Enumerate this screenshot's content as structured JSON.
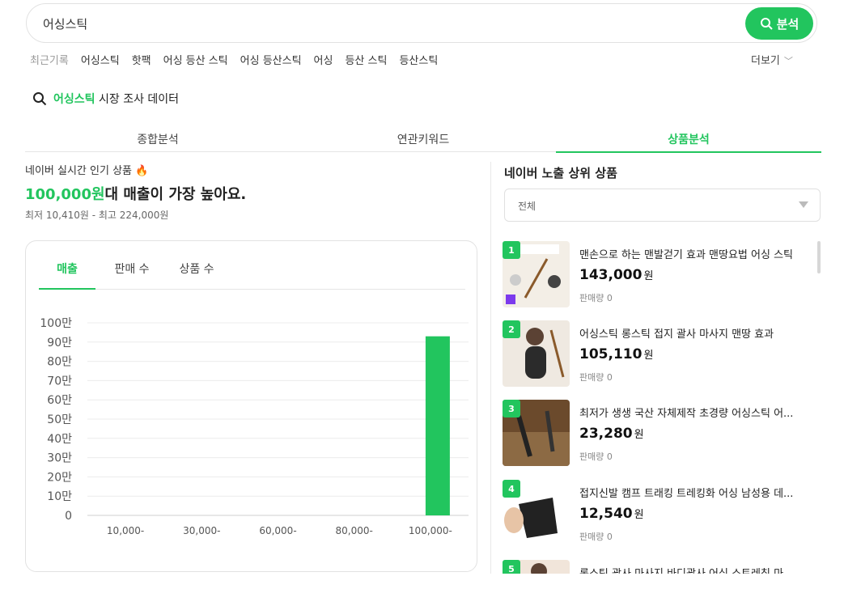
{
  "search": {
    "query": "어싱스틱",
    "button_label": "분석"
  },
  "recent": {
    "label": "최근기록",
    "items": [
      "어싱스틱",
      "핫팩",
      "어싱 등산 스틱",
      "어싱 등산스틱",
      "어싱",
      "등산 스틱",
      "등산스틱"
    ],
    "more_label": "더보기"
  },
  "heading": {
    "keyword": "어싱스틱",
    "suffix": "시장 조사 데이터"
  },
  "tabs": [
    "종합분석",
    "연관키워드",
    "상품분석"
  ],
  "summary": {
    "label": "네이버 실시간 인기 상품",
    "highlight": "100,000원",
    "headline_rest": "대 매출이 가장 높아요.",
    "range": "최저 10,410원 - 최고 224,000원"
  },
  "chart_tabs": [
    "매출",
    "판매 수",
    "상품 수"
  ],
  "chart_data": {
    "type": "bar",
    "categories": [
      "10,000-",
      "30,000-",
      "60,000-",
      "80,000-",
      "100,000-"
    ],
    "values": [
      0,
      0,
      0,
      0,
      930000
    ],
    "y_ticks": [
      "100만",
      "90만",
      "80만",
      "70만",
      "60만",
      "50만",
      "40만",
      "30만",
      "20만",
      "10만",
      "0"
    ],
    "ylim": [
      0,
      1000000
    ],
    "grid": true,
    "bar_color": "#22c55e"
  },
  "right": {
    "title": "네이버 노출 상위 상품",
    "filter_value": "전체"
  },
  "products": [
    {
      "rank": "1",
      "name": "맨손으로 하는 맨발걷기 효과 맨땅요법 어싱 스틱",
      "price": "143,000",
      "unit": "원",
      "sold": "판매량 0"
    },
    {
      "rank": "2",
      "name": "어싱스틱 롱스틱 접지 괄사 마사지 맨땅 효과",
      "price": "105,110",
      "unit": "원",
      "sold": "판매량 0"
    },
    {
      "rank": "3",
      "name": "최저가 생생 국산 자체제작 초경량 어싱스틱 어...",
      "price": "23,280",
      "unit": "원",
      "sold": "판매량 0"
    },
    {
      "rank": "4",
      "name": "접지신발 캠프 트래킹 트레킹화 어싱 남성용 데...",
      "price": "12,540",
      "unit": "원",
      "sold": "판매량 0"
    },
    {
      "rank": "5",
      "name": "롱스틱 괄사 마사지 바디괄사 어싱 스트레칭 마",
      "price": "",
      "unit": "",
      "sold": ""
    }
  ],
  "colors": {
    "accent": "#22c55e"
  }
}
